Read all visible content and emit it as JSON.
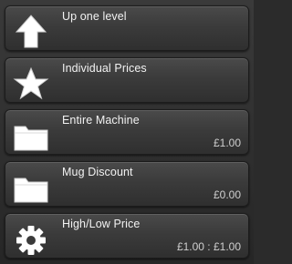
{
  "menu": {
    "items": [
      {
        "label": "Up one level",
        "value": "",
        "icon": "up-arrow-icon"
      },
      {
        "label": "Individual Prices",
        "value": "",
        "icon": "star-icon"
      },
      {
        "label": "Entire Machine",
        "value": "£1.00",
        "icon": "folder-icon"
      },
      {
        "label": "Mug Discount",
        "value": "£0.00",
        "icon": "folder-icon"
      },
      {
        "label": "High/Low Price",
        "value": "£1.00 : £1.00",
        "icon": "gear-icon"
      }
    ]
  },
  "colors": {
    "background": "#2b2b2b",
    "item_top": "#4a4a4a",
    "item_bottom": "#2f2f2f",
    "label_text": "#f2f2f2",
    "icon_fill": "#ffffff"
  }
}
